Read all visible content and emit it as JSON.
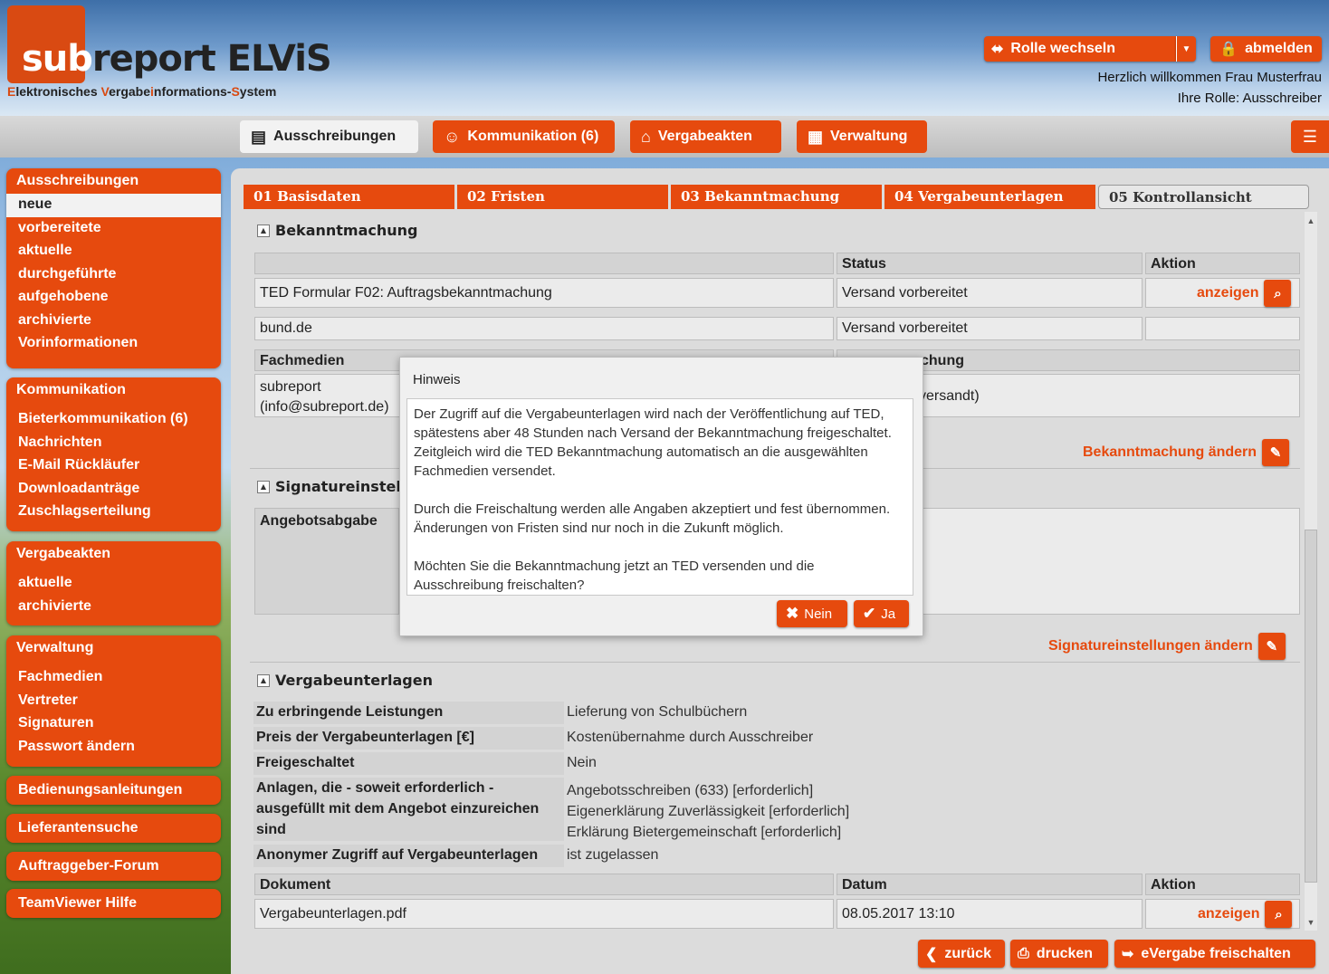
{
  "header": {
    "logo_part1": "sub",
    "logo_part2": "report ELViS",
    "subtitle": {
      "s1": "E",
      "s2": "lektronisches ",
      "s3": "V",
      "s4": "ergabe",
      "s5": "i",
      "s6": "nformations-",
      "s7": "S",
      "s8": "ystem"
    },
    "role_switch_label": "Rolle wechseln",
    "logout_label": "abmelden",
    "welcome": "Herzlich willkommen Frau Musterfrau",
    "role_line": "Ihre Rolle: Ausschreiber"
  },
  "nav": {
    "tabs": [
      {
        "label": "Ausschreibungen"
      },
      {
        "label": "Kommunikation (6)"
      },
      {
        "label": "Vergabeakten"
      },
      {
        "label": "Verwaltung"
      }
    ]
  },
  "sidebar": {
    "ausschreibungen": {
      "title": "Ausschreibungen",
      "items": [
        "neue",
        "vorbereitete",
        "aktuelle",
        "durchgeführte",
        "aufgehobene",
        "archivierte",
        "Vorinformationen"
      ]
    },
    "kommunikation": {
      "title": "Kommunikation",
      "items": [
        "Bieterkommunikation (6)",
        "Nachrichten",
        "E-Mail Rückläufer",
        "Downloadanträge",
        "Zuschlagserteilung"
      ]
    },
    "vergabeakten": {
      "title": "Vergabeakten",
      "items": [
        "aktuelle",
        "archivierte"
      ]
    },
    "verwaltung": {
      "title": "Verwaltung",
      "items": [
        "Fachmedien",
        "Vertreter",
        "Signaturen",
        "Passwort ändern"
      ]
    },
    "singles": [
      "Bedienungsanleitungen",
      "Lieferantensuche",
      "Auftraggeber-Forum",
      "TeamViewer Hilfe"
    ]
  },
  "steps": [
    "01 Basisdaten",
    "02 Fristen",
    "03 Bekanntmachung",
    "04 Vergabeunterlagen",
    "05 Kontrollansicht"
  ],
  "bekanntmachung": {
    "title": "Bekanntmachung",
    "col_status": "Status",
    "col_aktion": "Aktion",
    "rows": [
      {
        "name": "TED Formular F02: Auftragsbekanntmachung",
        "status": "Versand vorbereitet",
        "action": "anzeigen"
      },
      {
        "name": "bund.de",
        "status": "Versand vorbereitet",
        "action": ""
      }
    ],
    "fachmedien_header": "Fachmedien",
    "second_header_visible": "chung",
    "fachmedien_line1": "subreport",
    "fachmedien_line2": "(info@subreport.de)",
    "fachmedien_status_visible": "versandt)",
    "change_link": "Bekanntmachung ändern"
  },
  "signatur": {
    "title_visible": "Signatureinstellu",
    "angebotsabgabe": "Angebotsabgabe",
    "change_link": "Signatureinstellungen ändern"
  },
  "vergabeunterlagen": {
    "title": "Vergabeunterlagen",
    "fields": [
      {
        "label": "Zu erbringende Leistungen",
        "value": "Lieferung von Schulbüchern"
      },
      {
        "label": "Preis der Vergabeunterlagen [€]",
        "value": "Kostenübernahme durch Ausschreiber"
      },
      {
        "label": "Freigeschaltet",
        "value": "Nein"
      }
    ],
    "anlagen_label_l1": "Anlagen, die - soweit erforderlich -",
    "anlagen_label_l2": "ausgefüllt mit dem Angebot einzureichen",
    "anlagen_label_l3": "sind",
    "anlagen_values": [
      "Angebotsschreiben (633) [erforderlich]",
      "Eigenerklärung Zuverlässigkeit [erforderlich]",
      "Erklärung Bietergemeinschaft [erforderlich]"
    ],
    "anonym_label": "Anonymer Zugriff auf Vergabeunterlagen",
    "anonym_value": "ist zugelassen",
    "doc_col_dokument": "Dokument",
    "doc_col_datum": "Datum",
    "doc_col_aktion": "Aktion",
    "doc_name": "Vergabeunterlagen.pdf",
    "doc_date": "08.05.2017 13:10",
    "doc_action": "anzeigen"
  },
  "footer": {
    "back": "zurück",
    "print": "drucken",
    "release": "eVergabe freischalten"
  },
  "dialog": {
    "title": "Hinweis",
    "p1": "Der Zugriff auf die Vergabeunterlagen wird nach der Veröffentlichung auf TED, spätestens aber 48 Stunden nach Versand der Bekanntmachung freigeschaltet. Zeitgleich wird die TED Bekanntmachung automatisch an die ausgewählten Fachmedien versendet.",
    "p2": "Durch die Freischaltung werden alle Angaben akzeptiert und fest übernommen. Änderungen von Fristen sind nur noch in die Zukunft möglich.",
    "p3": "Möchten Sie die Bekanntmachung jetzt an TED versenden und die Ausschreibung freischalten?",
    "no": "Nein",
    "yes": "Ja"
  },
  "colors": {
    "accent": "#e64a0e",
    "panel": "#dcdcdc"
  },
  "icons": [
    "arrows-icon",
    "lock-icon",
    "document-icon",
    "user-chat-icon",
    "folder-icon",
    "calendar-grid-icon",
    "list-icon",
    "preview-icon",
    "pencil-icon",
    "close-icon",
    "check-icon",
    "chevron-left-icon",
    "printer-icon",
    "release-icon"
  ]
}
